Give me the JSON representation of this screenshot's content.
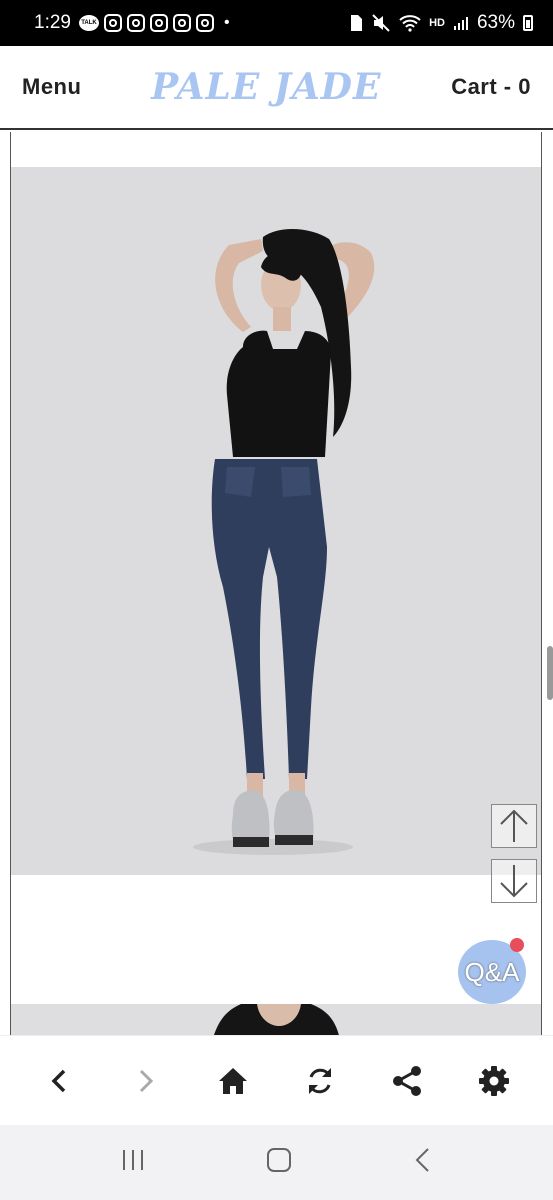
{
  "status": {
    "time": "1:29",
    "talk_label": "TALK",
    "hd_label": "HD",
    "battery_percent": "63%"
  },
  "header": {
    "menu_label": "Menu",
    "logo_text": "PALE JADE",
    "cart_label": "Cart - 0"
  },
  "qa": {
    "label": "Q&A"
  },
  "colors": {
    "logo": "#a9c6f2",
    "qa_button": "#a6c2ef",
    "qa_badge": "#e84d5b"
  },
  "icons": {
    "scroll_up": "arrow-up-icon",
    "scroll_down": "arrow-down-icon",
    "back": "chevron-left-icon",
    "forward": "chevron-right-icon",
    "home": "home-icon",
    "refresh": "refresh-icon",
    "share": "share-icon",
    "settings": "gear-icon"
  }
}
